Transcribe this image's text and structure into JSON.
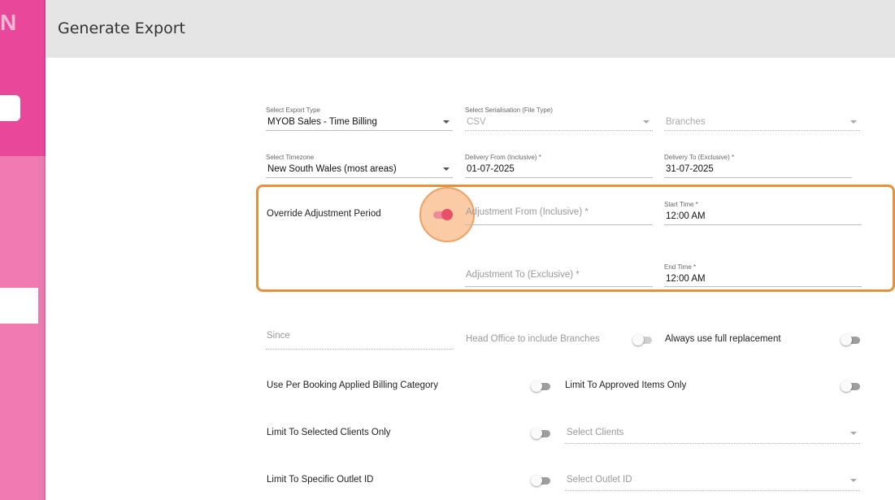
{
  "sidebar": {
    "logo_text": "N"
  },
  "header": {
    "title": "Generate Export"
  },
  "form": {
    "export_type": {
      "label": "Select Export Type",
      "value": "MYOB Sales - Time Billing"
    },
    "serialisation": {
      "label": "Select Serialisation (File Type)",
      "value": "CSV"
    },
    "branches": {
      "placeholder": "Branches"
    },
    "timezone": {
      "label": "Select Timezone",
      "value": "New South Wales (most areas)"
    },
    "delivery_from": {
      "label": "Delivery From (Inclusive) *",
      "value": "01-07-2025"
    },
    "delivery_to": {
      "label": "Delivery To (Exclusive) *",
      "value": "31-07-2025"
    },
    "override_adjustment": {
      "label": "Override Adjustment Period",
      "enabled": true
    },
    "adjustment_from": {
      "placeholder": "Adjustment From (Inclusive) *"
    },
    "start_time": {
      "label": "Start Time *",
      "value": "12:00 AM"
    },
    "adjustment_to": {
      "placeholder": "Adjustment To (Exclusive) *"
    },
    "end_time": {
      "label": "End Time *",
      "value": "12:00 AM"
    },
    "since": {
      "placeholder": "Since"
    },
    "head_office": {
      "label": "Head Office to include Branches",
      "enabled": false
    },
    "full_replacement": {
      "label": "Always use full replacement",
      "enabled": false
    },
    "per_booking": {
      "label": "Use Per Booking Applied Billing Category",
      "enabled": false
    },
    "approved_items": {
      "label": "Limit To Approved Items Only",
      "enabled": false
    },
    "selected_clients": {
      "label": "Limit To Selected Clients Only",
      "enabled": false
    },
    "select_clients": {
      "placeholder": "Select Clients"
    },
    "specific_outlet": {
      "label": "Limit To Specific Outlet ID",
      "enabled": false
    },
    "select_outlet": {
      "placeholder": "Select Outlet ID"
    }
  },
  "colors": {
    "brand": "#e8479a",
    "sidebar": "#f07ab1",
    "toggle_on": "#e8506a",
    "highlight": "#e8913d"
  }
}
